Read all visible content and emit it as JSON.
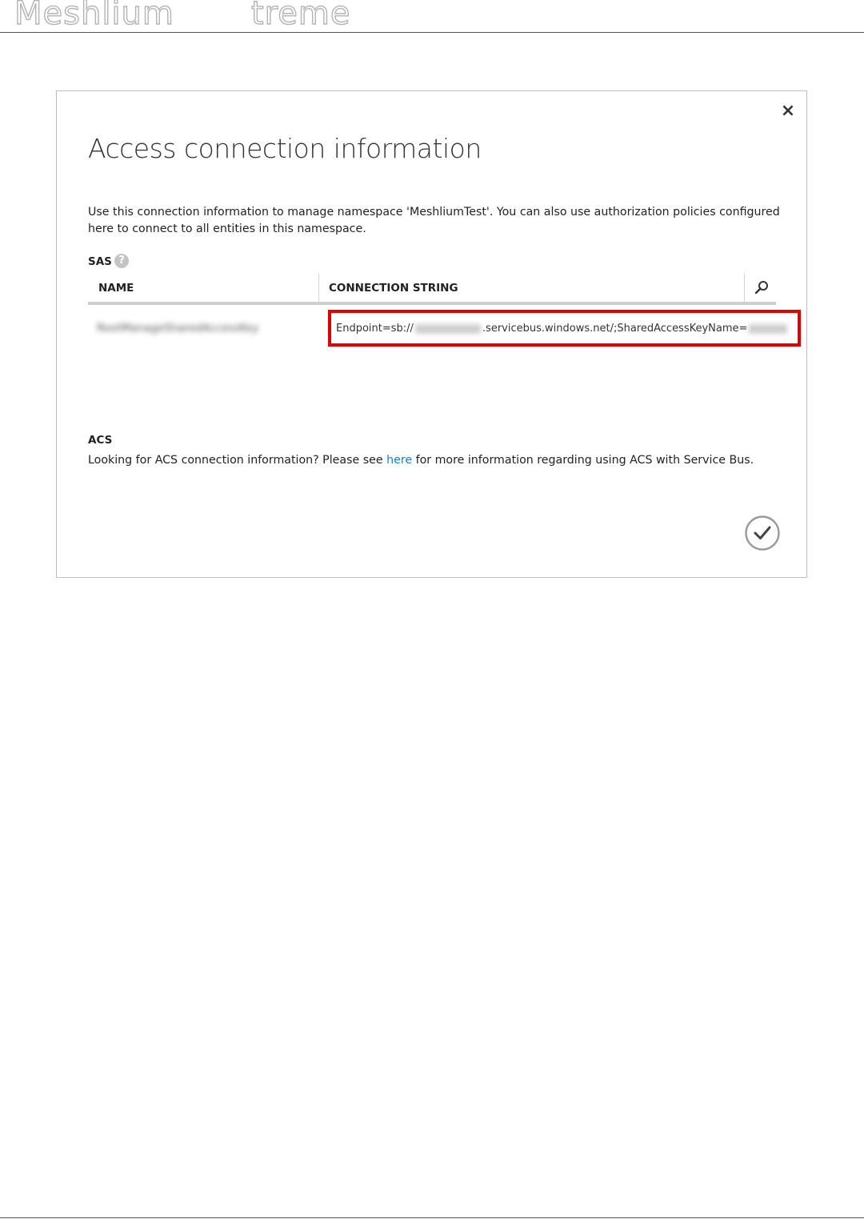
{
  "header": {
    "brand_left": "Meshlium",
    "brand_right": "treme"
  },
  "dialog": {
    "close_label": "×",
    "title": "Access connection information",
    "description": "Use this connection information to manage namespace 'MeshliumTest'. You can also use authorization policies configured here to connect to all entities in this namespace.",
    "sas_label": "SAS",
    "help_label": "?",
    "table": {
      "headers": [
        "NAME",
        "CONNECTION STRING"
      ],
      "row": {
        "name": "RootManageSharedAccessKey",
        "connection_prefix": "Endpoint=sb://",
        "connection_middle": ".servicebus.windows.net/;SharedAccessKeyName="
      }
    },
    "acs_label": "ACS",
    "acs_text_before": "Looking for ACS connection information? Please see ",
    "acs_link": "here",
    "acs_text_after": " for more information regarding using ACS with Service Bus."
  },
  "colors": {
    "highlight_border": "#e00000",
    "link": "#1a7fc9"
  },
  "icons": {
    "search": "search-icon",
    "close": "close-icon",
    "help": "help-icon",
    "confirm": "checkmark-circle-icon"
  }
}
